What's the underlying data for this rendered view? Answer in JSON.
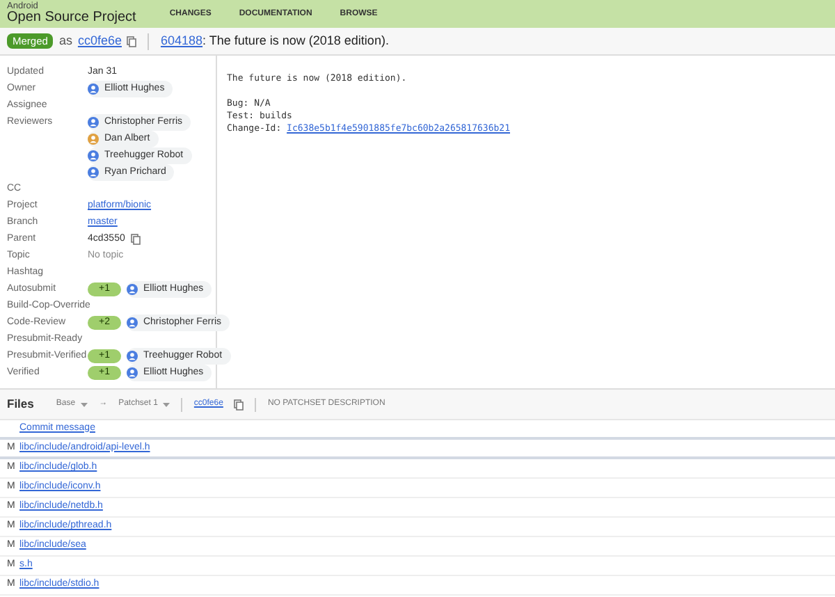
{
  "header": {
    "brand_top": "Android",
    "brand": "Open Source Project",
    "nav": [
      "CHANGES",
      "DOCUMENTATION",
      "BROWSE"
    ]
  },
  "change": {
    "status": "Merged",
    "as": "as",
    "commit": "cc0fe6e",
    "number": "604188",
    "title": ": The future is now (2018 edition)."
  },
  "metadata": [
    {
      "kind": "text",
      "label": "Updated",
      "value": "Jan 31"
    },
    {
      "kind": "people",
      "label": "Owner",
      "people": [
        "Elliott Hughes"
      ]
    },
    {
      "kind": "empty",
      "label": "Assignee"
    },
    {
      "kind": "people",
      "label": "Reviewers",
      "people": [
        "Christopher Ferris",
        "Dan Albert",
        "Treehugger Robot",
        "Ryan Prichard"
      ]
    },
    {
      "kind": "empty",
      "label": "CC"
    },
    {
      "kind": "link",
      "label": "Project",
      "value": "platform/bionic"
    },
    {
      "kind": "link",
      "label": "Branch",
      "value": "master"
    },
    {
      "kind": "copy",
      "label": "Parent",
      "value": "4cd3550"
    },
    {
      "kind": "muted",
      "label": "Topic",
      "value": "No topic"
    },
    {
      "kind": "empty",
      "label": "Hashtag"
    },
    {
      "kind": "vote",
      "label": "Autosubmit",
      "vote": "+1",
      "person": "Elliott Hughes"
    },
    {
      "kind": "empty",
      "label": "Build-Cop-Override"
    },
    {
      "kind": "vote",
      "label": "Code-Review",
      "vote": "+2",
      "person": "Christopher Ferris"
    },
    {
      "kind": "empty",
      "label": "Presubmit-Ready"
    },
    {
      "kind": "vote",
      "label": "Presubmit-Verified",
      "vote": "+1",
      "person": "Treehugger Robot"
    },
    {
      "kind": "vote",
      "label": "Verified",
      "vote": "+1",
      "person": "Elliott Hughes"
    }
  ],
  "message": {
    "summary": "The future is now (2018 edition).",
    "lines": [
      "Bug: N/A",
      "Test: builds"
    ],
    "change_id_label": "Change-Id: ",
    "change_id": "Ic638e5b1f4e5901885fe7bc60b2a265817636b21"
  },
  "files": {
    "title": "Files",
    "base": "Base",
    "arrow": "→",
    "patchset": "Patchset 1",
    "commit": "cc0fe6e",
    "description": "NO PATCHSET DESCRIPTION",
    "commit_message": "Commit message",
    "rows": [
      {
        "status": "M",
        "path": "libc/include/android/api-level.h"
      },
      {
        "status": "M",
        "path": "libc/include/glob.h"
      },
      {
        "status": "M",
        "path": "libc/include/iconv.h"
      },
      {
        "status": "M",
        "path": "libc/include/netdb.h"
      },
      {
        "status": "M",
        "path": "libc/include/pthread.h"
      },
      {
        "status": "M",
        "path": "libc/include/sea"
      },
      {
        "status": "M",
        "path": "s.h"
      },
      {
        "status": "M",
        "path": "libc/include/stdio.h"
      }
    ]
  }
}
